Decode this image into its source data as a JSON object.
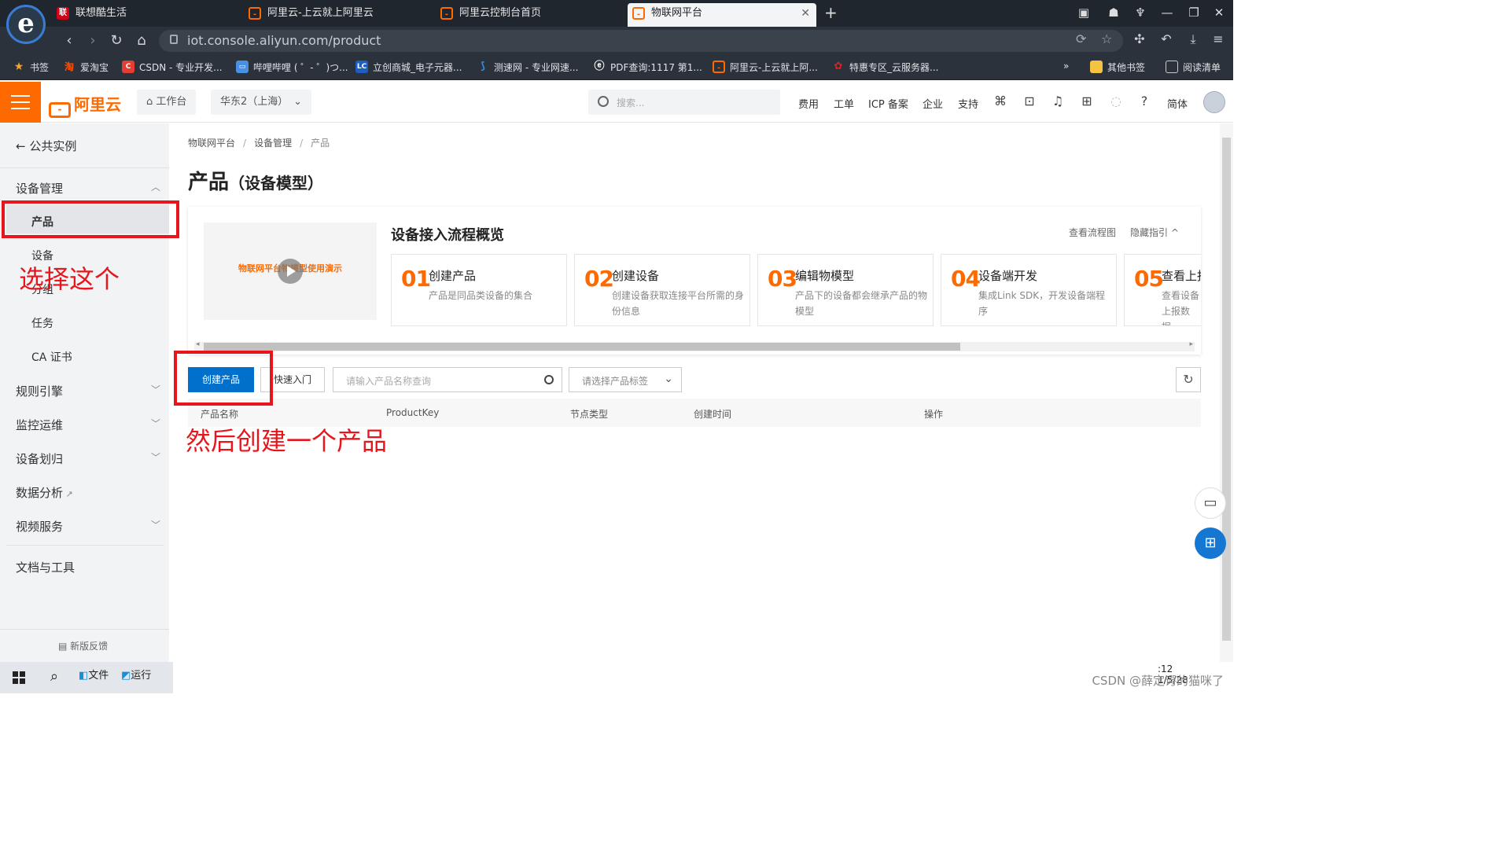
{
  "browser": {
    "tabs": [
      {
        "label": "联想酷生活",
        "favicon": "lenovo-icon"
      },
      {
        "label": "阿里云-上云就上阿里云",
        "favicon": "aliyun-icon"
      },
      {
        "label": "阿里云控制台首页",
        "favicon": "aliyun-icon"
      },
      {
        "label": "物联网平台",
        "favicon": "aliyun-icon"
      }
    ],
    "url": "iot.console.aliyun.com/product",
    "bookmarks": [
      "书签",
      "爱淘宝",
      "CSDN - 专业开发...",
      "哔哩哔哩 ( ゜- ゜)つ...",
      "立创商城_电子元器...",
      "测速网 - 专业网速...",
      "PDF查询:1117 第1...",
      "阿里云-上云就上阿...",
      "特惠专区_云服务器...",
      "其他书签",
      "阅读清单"
    ]
  },
  "console": {
    "brand": "阿里云",
    "workbench": "工作台",
    "region": "华东2（上海）",
    "search_placeholder": "搜索...",
    "links": [
      "费用",
      "工单",
      "ICP 备案",
      "企业",
      "支持"
    ],
    "lang": "简体"
  },
  "sidebar": {
    "back": "公共实例",
    "group_device": "设备管理",
    "sub_items": [
      "产品",
      "设备",
      "分组",
      "任务",
      "CA 证书"
    ],
    "groups": [
      "规则引擎",
      "监控运维",
      "设备划归",
      "数据分析",
      "视频服务"
    ],
    "docs": "文档与工具",
    "feedback": "新版反馈"
  },
  "main": {
    "breadcrumb": [
      "物联网平台",
      "设备管理",
      "产品"
    ],
    "title": "产品",
    "title_sub": "（设备模型）",
    "guide": {
      "video_text": "物联网平台物模型使用演示",
      "title": "设备接入流程概览",
      "view_flow": "查看流程图",
      "hide_guide": "隐藏指引",
      "steps": [
        {
          "num": "01",
          "title": "创建产品",
          "desc": "产品是同品类设备的集合"
        },
        {
          "num": "02",
          "title": "创建设备",
          "desc": "创建设备获取连接平台所需的身份信息"
        },
        {
          "num": "03",
          "title": "编辑物模型",
          "desc": "产品下的设备都会继承产品的物模型"
        },
        {
          "num": "04",
          "title": "设备端开发",
          "desc": "集成Link SDK，开发设备端程序"
        },
        {
          "num": "05",
          "title": "查看上报",
          "desc": "查看设备上报数据，SDK，开"
        }
      ]
    },
    "toolbar": {
      "create": "创建产品",
      "quick_start": "快速入门",
      "search_placeholder": "请输入产品名称查询",
      "tag_placeholder": "请选择产品标签"
    },
    "table_headers": [
      "产品名称",
      "ProductKey",
      "节点类型",
      "创建时间",
      "操作"
    ]
  },
  "annotations": {
    "select_this": "选择这个",
    "then_create": "然后创建一个产品"
  },
  "taskbar": {
    "items": [
      "文件",
      "运行"
    ],
    "watermark": "CSDN @薛定谔的猫咪了",
    "time": ":12",
    "date": "1/5/28"
  },
  "colors": {
    "brand_orange": "#ff6a00",
    "primary_blue": "#0070cc",
    "annotation_red": "#e8151c"
  }
}
